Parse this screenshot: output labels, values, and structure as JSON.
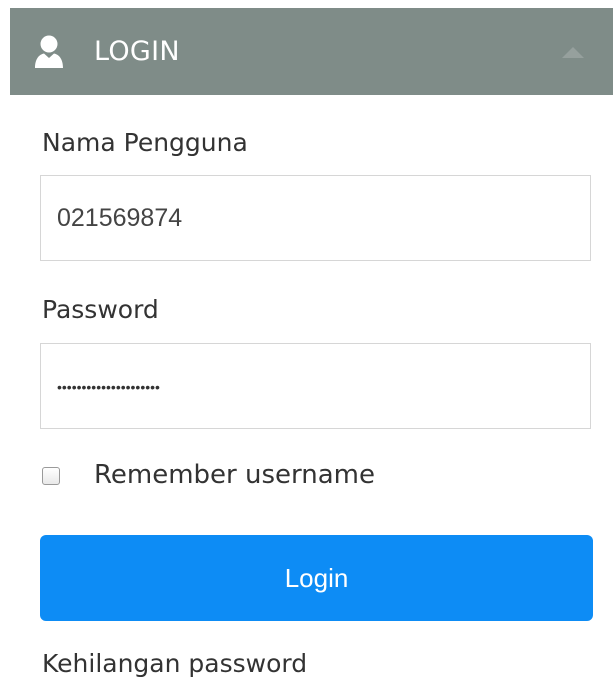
{
  "panel": {
    "title": "LOGIN",
    "header_color": "#7f8c88",
    "icons": {
      "header_icon": "user-icon",
      "collapse_icon": "chevron-up-icon"
    }
  },
  "form": {
    "username": {
      "label": "Nama Pengguna",
      "value": "021569874",
      "placeholder": ""
    },
    "password": {
      "label": "Password",
      "value": "•••••••••••••••••••••",
      "masked": true
    },
    "remember": {
      "label": "Remember username",
      "checked": false
    },
    "submit_label": "Login",
    "submit_color": "#0d8cf5",
    "forgot_label": "Kehilangan password"
  }
}
